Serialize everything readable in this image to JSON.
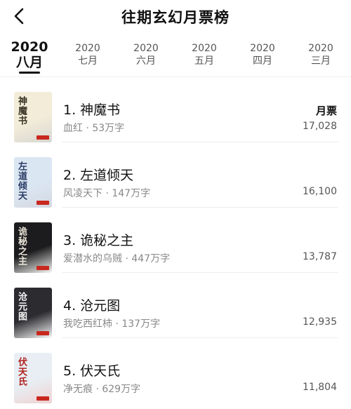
{
  "header": {
    "title": "往期玄幻月票榜",
    "back_icon": "chevron-left-icon"
  },
  "tabs": [
    {
      "year": "2020",
      "month": "八月",
      "active": true
    },
    {
      "year": "2020",
      "month": "七月"
    },
    {
      "year": "2020",
      "month": "六月"
    },
    {
      "year": "2020",
      "month": "五月"
    },
    {
      "year": "2020",
      "month": "四月"
    },
    {
      "year": "2020",
      "month": "三月"
    }
  ],
  "votes_label": "月票",
  "books": [
    {
      "rank_title": "1. 神魔书",
      "meta": "血红 · 53万字",
      "votes": "17,028",
      "cover_text": "神魔书",
      "cover_colors": [
        "#f3ecd8",
        "#3a3426"
      ]
    },
    {
      "rank_title": "2. 左道倾天",
      "meta": "风凌天下 · 147万字",
      "votes": "16,100",
      "cover_text": "左道倾天",
      "cover_colors": [
        "#dbe6f3",
        "#2a3c66"
      ]
    },
    {
      "rank_title": "3. 诡秘之主",
      "meta": "爱潜水的乌贼 · 447万字",
      "votes": "13,787",
      "cover_text": "诡秘之主",
      "cover_colors": [
        "#1c1c1e",
        "#e8e2d6"
      ]
    },
    {
      "rank_title": "4. 沧元图",
      "meta": "我吃西红柿 · 137万字",
      "votes": "12,935",
      "cover_text": "沧元图",
      "cover_colors": [
        "#2b2b30",
        "#f2f2f2"
      ]
    },
    {
      "rank_title": "5. 伏天氏",
      "meta": "净无痕 · 629万字",
      "votes": "11,804",
      "cover_text": "伏天氏",
      "cover_colors": [
        "#e8eef3",
        "#b0201f"
      ]
    }
  ]
}
